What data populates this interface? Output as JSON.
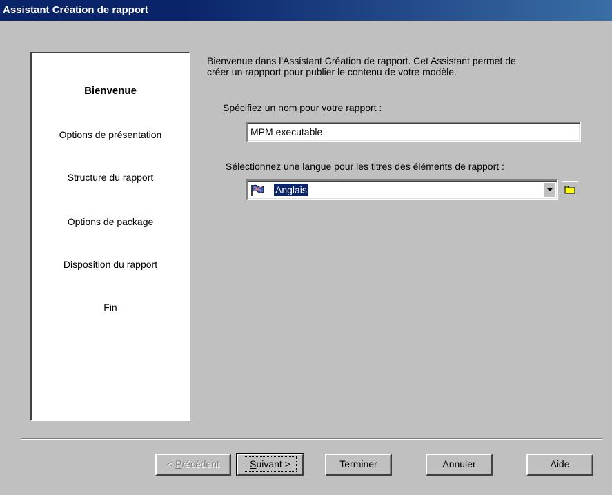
{
  "window": {
    "title": "Assistant Création de rapport"
  },
  "steps": [
    {
      "label": "Bienvenue",
      "active": true
    },
    {
      "label": "Options de présentation",
      "active": false
    },
    {
      "label": "Structure du rapport",
      "active": false
    },
    {
      "label": "Options de package",
      "active": false
    },
    {
      "label": "Disposition du rapport",
      "active": false
    },
    {
      "label": "Fin",
      "active": false
    }
  ],
  "main": {
    "intro_line1": "Bienvenue dans l'Assistant Création de rapport. Cet Assistant permet de",
    "intro_line2": "créer un rappport pour publier le contenu de votre modèle.",
    "name_label": "Spécifiez un nom pour votre rapport :",
    "name_value": "MPM executable",
    "language_label": "Sélectionnez une langue pour les titres des éléments de rapport :",
    "language_value": "Anglais"
  },
  "buttons": {
    "previous_mnemonic": "P",
    "previous_prefix": "< ",
    "previous_rest": "récédent",
    "next_mnemonic": "S",
    "next_rest": "uivant >",
    "finish": "Terminer",
    "cancel": "Annuler",
    "help": "Aide"
  },
  "colors": {
    "titlebar": "#0a246a",
    "dialog_bg": "#c0c0c0",
    "selection": "#0a246a"
  },
  "icons": {
    "language_flag": "flag-icon",
    "browse_folder": "folder-icon"
  }
}
